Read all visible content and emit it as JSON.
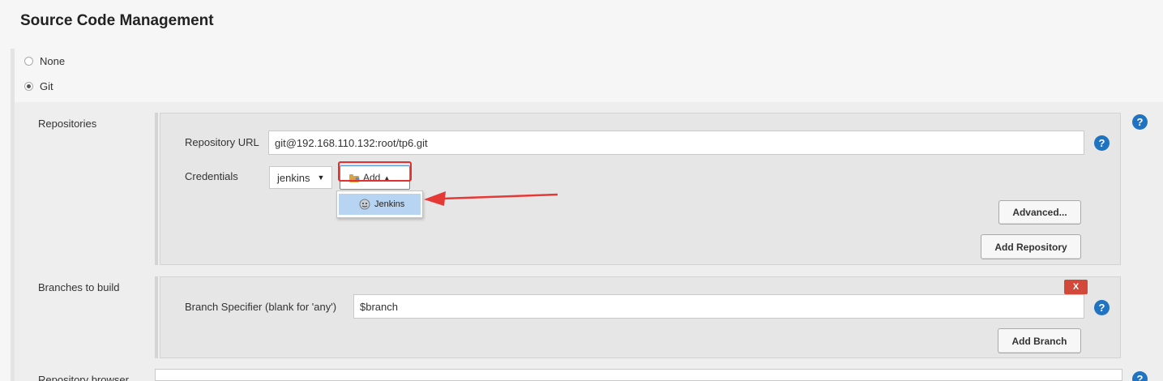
{
  "section": {
    "title": "Source Code Management"
  },
  "scm_options": [
    {
      "label": "None",
      "checked": false
    },
    {
      "label": "Git",
      "checked": true
    }
  ],
  "repositories": {
    "label": "Repositories",
    "url_label": "Repository URL",
    "url_value": "git@192.168.110.132:root/tp6.git",
    "credentials_label": "Credentials",
    "credentials_value": "jenkins",
    "add_label": "Add",
    "add_menu": [
      {
        "label": "Jenkins",
        "icon": "jenkins-icon"
      }
    ],
    "advanced_label": "Advanced...",
    "add_repository_label": "Add Repository"
  },
  "branches": {
    "label": "Branches to build",
    "specifier_label": "Branch Specifier (blank for 'any')",
    "specifier_value": "$branch",
    "delete_label": "X",
    "add_branch_label": "Add Branch"
  },
  "repository_browser": {
    "label": "Repository browser"
  },
  "help_symbol": "?",
  "colors": {
    "help": "#1f73c1",
    "highlight": "#e23131",
    "delete": "#d24939",
    "menu_selected": "#b7d5f3"
  }
}
